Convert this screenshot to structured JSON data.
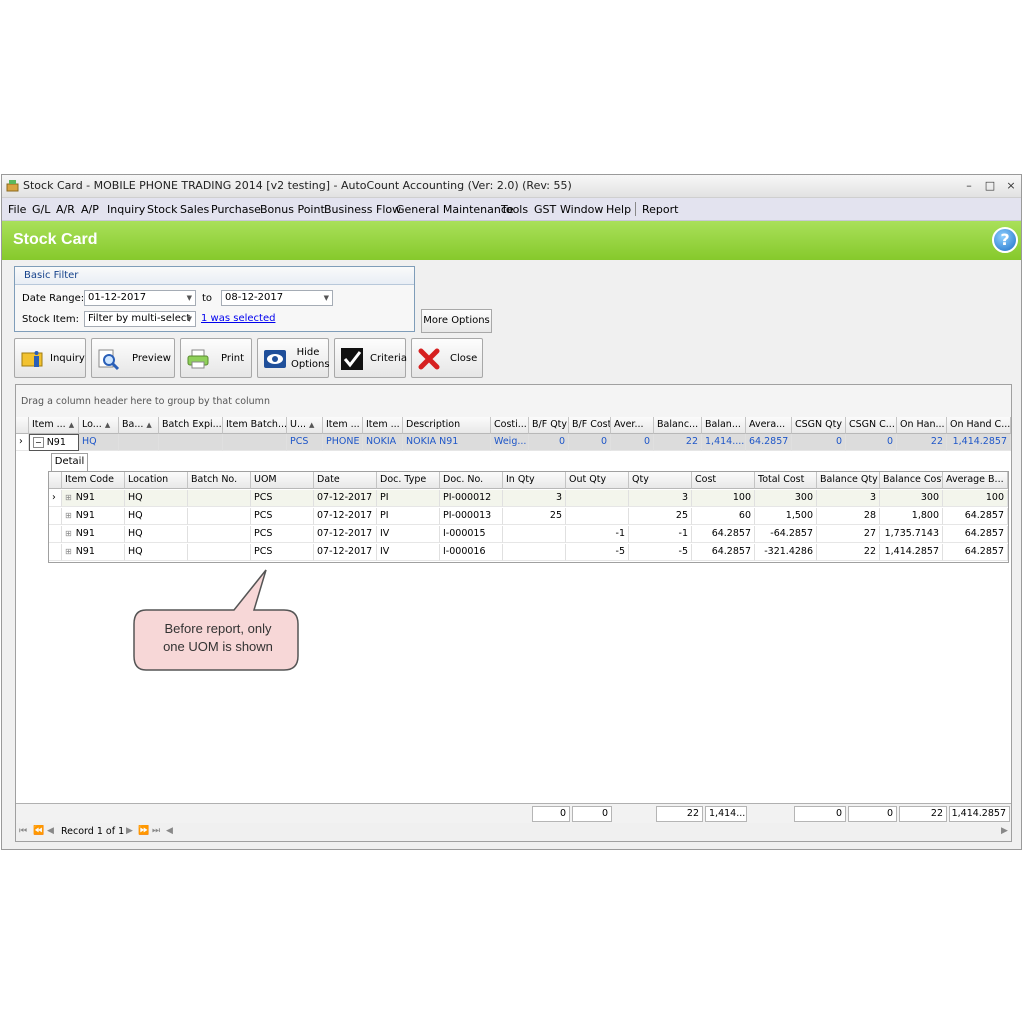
{
  "window": {
    "title": "Stock Card - MOBILE PHONE TRADING 2014 [v2 testing] - AutoCount Accounting (Ver: 2.0) (Rev: 55)",
    "minimize": "–",
    "maximize": "□",
    "close": "×"
  },
  "menu": [
    "File",
    "G/L",
    "A/R",
    "A/P",
    "Inquiry",
    "Stock",
    "Sales",
    "Purchase",
    "Bonus Point",
    "Business Flow",
    "General Maintenance",
    "Tools",
    "GST",
    "Window",
    "Help",
    "Report"
  ],
  "banner": {
    "title": "Stock Card",
    "help": "?"
  },
  "filter": {
    "header": "Basic Filter",
    "date_label": "Date Range:",
    "date_from": "01-12-2017",
    "to_label": "to",
    "date_to": "08-12-2017",
    "stock_label": "Stock Item:",
    "stock_value": "Filter by multi-select",
    "selected_link": "1 was selected",
    "more_options": "More Options"
  },
  "toolbar": {
    "inquiry": "Inquiry",
    "preview": "Preview",
    "print": "Print",
    "hide_line1": "Hide",
    "hide_line2": "Options",
    "criteria": "Criteria",
    "close": "Close"
  },
  "grid": {
    "group_hint": "Drag a column header here to group by that column",
    "headers": [
      "Item ...",
      "Lo...",
      "Ba...",
      "Batch Expi...",
      "Item Batch...",
      "U...",
      "Item ...",
      "Item ...",
      "Description",
      "Costi...",
      "B/F Qty",
      "B/F Cost",
      "Aver...",
      "Balanc...",
      "Balan...",
      "Avera...",
      "CSGN Qty",
      "CSGN C...",
      "On Han...",
      "On Hand C..."
    ],
    "master_row": [
      "N91",
      "HQ",
      "",
      "",
      "",
      "PCS",
      "PHONE",
      "NOKIA",
      "NOKIA N91",
      "Weig...",
      "0",
      "0",
      "0",
      "22",
      "1,414....",
      "64.2857",
      "0",
      "0",
      "22",
      "1,414.2857"
    ],
    "detail_tab": "Detail",
    "detail_headers": [
      "Item Code",
      "Location",
      "Batch No.",
      "UOM",
      "Date",
      "Doc. Type",
      "Doc. No.",
      "In Qty",
      "Out Qty",
      "Qty",
      "Cost",
      "Total Cost",
      "Balance Qty",
      "Balance Cost",
      "Average B..."
    ],
    "detail_rows": [
      [
        "N91",
        "HQ",
        "",
        "PCS",
        "07-12-2017",
        "PI",
        "PI-000012",
        "3",
        "",
        "3",
        "100",
        "300",
        "3",
        "300",
        "100"
      ],
      [
        "N91",
        "HQ",
        "",
        "PCS",
        "07-12-2017",
        "PI",
        "PI-000013",
        "25",
        "",
        "25",
        "60",
        "1,500",
        "28",
        "1,800",
        "64.2857"
      ],
      [
        "N91",
        "HQ",
        "",
        "PCS",
        "07-12-2017",
        "IV",
        "I-000015",
        "",
        "-1",
        "-1",
        "64.2857",
        "-64.2857",
        "27",
        "1,735.7143",
        "64.2857"
      ],
      [
        "N91",
        "HQ",
        "",
        "PCS",
        "07-12-2017",
        "IV",
        "I-000016",
        "",
        "-5",
        "-5",
        "64.2857",
        "-321.4286",
        "22",
        "1,414.2857",
        "64.2857"
      ]
    ],
    "footer": [
      "0",
      "0",
      "22",
      "1,414...",
      "0",
      "0",
      "22",
      "1,414.2857"
    ],
    "record_text": "Record 1 of 1"
  },
  "callout": {
    "line1": "Before report, only",
    "line2": "one UOM is shown"
  },
  "colors": {
    "banner": "#8ccf30",
    "link": "#1e56c8",
    "callout_fill": "#f7d7d7"
  }
}
